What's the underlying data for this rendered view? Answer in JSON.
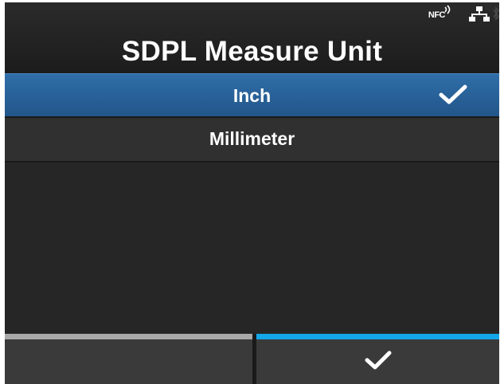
{
  "header": {
    "title": "SDPL Measure Unit",
    "status_icons": [
      "nfc-icon",
      "lan-icon"
    ],
    "nfc_label": "NFC"
  },
  "options": [
    {
      "label": "Inch",
      "selected": true,
      "checked": true
    },
    {
      "label": "Millimeter",
      "selected": false,
      "checked": false
    }
  ],
  "softkeys": {
    "left": {
      "label": "",
      "indicator_color": "#a9a9a9"
    },
    "right": {
      "icon": "checkmark-icon",
      "indicator_color": "#13a6e8"
    }
  },
  "colors": {
    "background": "#262626",
    "selection": "#2a639b",
    "text": "#ffffff"
  }
}
